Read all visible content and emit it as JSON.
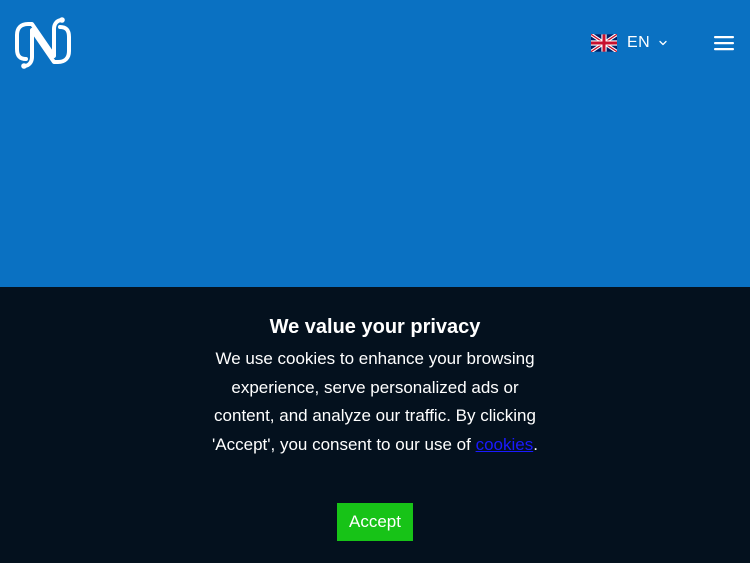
{
  "header": {
    "language": {
      "code": "EN",
      "flag_icon": "uk-flag-icon"
    },
    "logo_icon": "brand-logo-icon",
    "menu_icon": "hamburger-menu-icon"
  },
  "cookie_banner": {
    "title": "We value your privacy",
    "body_text": "We use cookies to enhance your browsing experience, serve personalized ads or content, and analyze our traffic. By clicking 'Accept', you consent to our use of",
    "link_text": "cookies",
    "trailing_text": ".",
    "accept_label": "Accept"
  },
  "colors": {
    "hero_background": "#0a71c2",
    "banner_background": "#04111e",
    "accept_button": "#17c317",
    "link": "#1a1aff"
  }
}
